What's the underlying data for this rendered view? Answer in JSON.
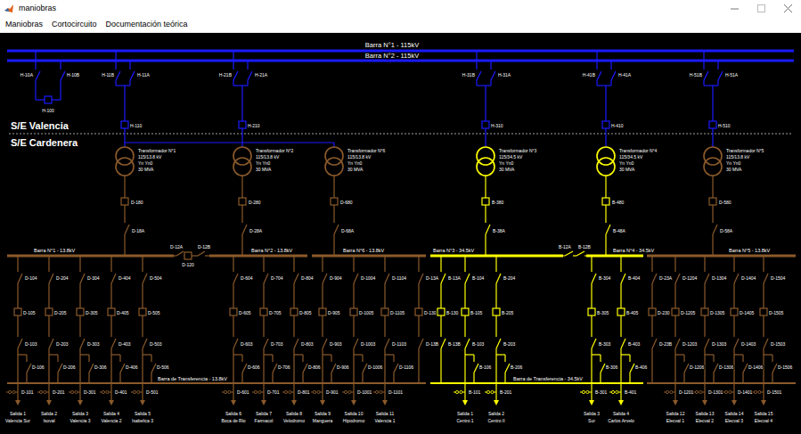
{
  "window": {
    "title": "maniobras"
  },
  "menu": [
    {
      "label": "Maniobras"
    },
    {
      "label": "Cortocircuito"
    },
    {
      "label": "Documentación teórica"
    }
  ],
  "substations": {
    "upper": "S/E Valencia",
    "lower": "S/E Cardenera"
  },
  "hv_buses": [
    {
      "label": "Barra N°1 - 115kV",
      "color": "#1a1aff"
    },
    {
      "label": "Barra N°2 - 115kV",
      "color": "#1a1aff"
    }
  ],
  "hv_coupler": {
    "switch_a": "H-10A",
    "switch_b": "H-10B",
    "breaker": "H-100",
    "color": "#1a1aff"
  },
  "hv_bays": [
    {
      "switch_b": "H-11B",
      "switch_a": "H-11A",
      "breaker": "H-110",
      "color": "#1a1aff"
    },
    {
      "switch_b": "H-21B",
      "switch_a": "H-21A",
      "breaker": "H-210",
      "color": "#1a1aff"
    },
    {
      "switch_b": "H-31B",
      "switch_a": "H-31A",
      "breaker": "H-310",
      "color": "#1a1aff"
    },
    {
      "switch_b": "H-41B",
      "switch_a": "H-41A",
      "breaker": "H-410",
      "color": "#1a1aff"
    },
    {
      "switch_b": "H-51B",
      "switch_a": "H-51A",
      "breaker": "H-510",
      "color": "#1a1aff"
    }
  ],
  "transformers": [
    {
      "name": "Transformador N°1",
      "ratio": "115/13.8 kV",
      "group": "Yn Yn0",
      "rating": "30 MVA",
      "breaker": "D-180",
      "switch": "D-18A",
      "color": "#8b5a2b"
    },
    {
      "name": "Transformador N°2",
      "ratio": "115/13.8 kV",
      "group": "Yn Yn0",
      "rating": "30 MVA",
      "breaker": "D-280",
      "switch": "D-28A",
      "color": "#8b5a2b"
    },
    {
      "name": "Transformador N°6",
      "ratio": "115/13.8 kV",
      "group": "Yn Yn0",
      "rating": "30 MVA",
      "breaker": "D-680",
      "switch": "D-68A",
      "color": "#8b5a2b"
    },
    {
      "name": "Transformador N°3",
      "ratio": "115/34.5 kV",
      "group": "Yn Yn0",
      "rating": "30 MVA",
      "breaker": "B-380",
      "switch": "B-38A",
      "color": "#ffff00"
    },
    {
      "name": "Transformador N°4",
      "ratio": "115/34.5 kV",
      "group": "Yn Yn0",
      "rating": "30 MVA",
      "breaker": "B-480",
      "switch": "B-48A",
      "color": "#ffff00"
    },
    {
      "name": "Transformador N°5",
      "ratio": "115/13.8 kV",
      "group": "Yn Yn0",
      "rating": "30 MVA",
      "breaker": "D-580",
      "switch": "D-58A",
      "color": "#8b5a2b"
    }
  ],
  "lv_buses": [
    {
      "label": "Barra N°1 - 13.8kV",
      "color": "#8b5a2b"
    },
    {
      "label": "Barra N°2 - 13.8kV",
      "color": "#8b5a2b"
    },
    {
      "label": "Barra N°6 - 13.8kV",
      "color": "#8b5a2b"
    },
    {
      "label": "Barra N°3 - 34.5kV",
      "color": "#ffff00"
    },
    {
      "label": "Barra N°4 - 34.5kV",
      "color": "#ffff00"
    },
    {
      "label": "Barra N°5 - 13.8kV",
      "color": "#8b5a2b"
    }
  ],
  "lv_couplers": [
    {
      "kind": "breaker",
      "switch_a": "D-12A",
      "breaker": "D-120",
      "switch_b": "D-12B",
      "color": "#8b5a2b"
    },
    {
      "kind": "switches",
      "switch_a": "B-12A",
      "switch_b": "B-12B",
      "color": "#ffff00"
    }
  ],
  "transfer_buses": [
    {
      "label": "Barra de Transferencia - 13.8kV",
      "color": "#8b5a2b"
    },
    {
      "label": "Barra de Transferencia - 34.5kV",
      "color": "#ffff00"
    },
    {
      "color": "#8b5a2b"
    }
  ],
  "transfer_couplers": [
    {
      "switch_top": "D-13A",
      "breaker": "D-130",
      "switch_bottom": "D-13B",
      "color": "#8b5a2b"
    },
    {
      "switch_top": "B-13A",
      "breaker": "B-130",
      "switch_bottom": "B-13B",
      "color": "#ffff00"
    },
    {
      "switch_top": "D-23A",
      "breaker": "D-230",
      "switch_bottom": "D-23B",
      "color": "#8b5a2b"
    }
  ],
  "feeders": [
    {
      "title": "Salida 1",
      "place": "Valencia Sur",
      "switch_top": "D-104",
      "breaker": "D-105",
      "switch_bottom": "D-103",
      "bypass": "D-106",
      "output": "D-101",
      "color": "#8b5a2b"
    },
    {
      "title": "Salida 2",
      "place": "Isoval",
      "switch_top": "D-204",
      "breaker": "D-205",
      "switch_bottom": "D-203",
      "bypass": "D-206",
      "output": "D-201",
      "color": "#8b5a2b"
    },
    {
      "title": "Salida 3",
      "place": "Valencia 3",
      "switch_top": "D-304",
      "breaker": "D-305",
      "switch_bottom": "D-303",
      "bypass": "D-306",
      "output": "D-301",
      "color": "#8b5a2b"
    },
    {
      "title": "Salida 4",
      "place": "Valencia 2",
      "switch_top": "D-404",
      "breaker": "D-405",
      "switch_bottom": "D-403",
      "bypass": "D-406",
      "output": "D-401",
      "color": "#8b5a2b"
    },
    {
      "title": "Salida 5",
      "place": "Isabelica 3",
      "switch_top": "D-504",
      "breaker": "D-505",
      "switch_bottom": "D-503",
      "bypass": "D-506",
      "output": "D-501",
      "color": "#8b5a2b"
    },
    {
      "title": "Salida 6",
      "place": "Boca de Rio",
      "switch_top": "D-604",
      "breaker": "D-605",
      "switch_bottom": "D-603",
      "bypass": "D-606",
      "output": "D-601",
      "color": "#8b5a2b"
    },
    {
      "title": "Salida 7",
      "place": "Farmacol",
      "switch_top": "D-704",
      "breaker": "D-705",
      "switch_bottom": "D-703",
      "bypass": "D-706",
      "output": "D-701",
      "color": "#8b5a2b"
    },
    {
      "title": "Salida 8",
      "place": "Velodromo",
      "switch_top": "D-804",
      "breaker": "D-805",
      "switch_bottom": "D-803",
      "bypass": "D-806",
      "output": "D-801",
      "color": "#8b5a2b"
    },
    {
      "title": "Salida 9",
      "place": "Manguera",
      "switch_top": "D-904",
      "breaker": "D-905",
      "switch_bottom": "D-903",
      "bypass": "D-906",
      "output": "D-901",
      "color": "#8b5a2b"
    },
    {
      "title": "Salida 10",
      "place": "Hipodromo",
      "switch_top": "D-1004",
      "breaker": "D-1005",
      "switch_bottom": "D-1003",
      "bypass": "D-1006",
      "output": "D-1001",
      "color": "#8b5a2b"
    },
    {
      "title": "Salida 11",
      "place": "Valencia 1",
      "switch_top": "D-1104",
      "breaker": "D-1105",
      "switch_bottom": "D-1103",
      "bypass": "D-1106",
      "output": "D-1101",
      "color": "#8b5a2b"
    },
    {
      "title": "Salida 1",
      "place": "Centro 1",
      "switch_top": "B-104",
      "breaker": "B-105",
      "switch_bottom": "B-103",
      "bypass": "B-106",
      "output": "B-101",
      "color": "#ffff00"
    },
    {
      "title": "Salida 2",
      "place": "Centro II",
      "switch_top": "B-204",
      "breaker": "B-205",
      "switch_bottom": "B-203",
      "bypass": "B-206",
      "output": "B-201",
      "color": "#ffff00"
    },
    {
      "title": "Salida 3",
      "place": "Sur",
      "switch_top": "B-304",
      "breaker": "B-305",
      "switch_bottom": "B-303",
      "bypass": "B-306",
      "output": "B-301",
      "color": "#ffff00"
    },
    {
      "title": "Salida 4",
      "place": "Carlos Arvelo",
      "switch_top": "B-404",
      "breaker": "B-405",
      "switch_bottom": "B-403",
      "bypass": "B-406",
      "output": "B-401",
      "color": "#ffff00"
    },
    {
      "title": "Salida 12",
      "place": "Elecval 1",
      "switch_top": "D-1204",
      "breaker": "D-1205",
      "switch_bottom": "D-1203",
      "bypass": "D-1206",
      "output": "D-1201",
      "color": "#8b5a2b"
    },
    {
      "title": "Salida 13",
      "place": "Elecval 2",
      "switch_top": "D-1304",
      "breaker": "D-1305",
      "switch_bottom": "D-1303",
      "bypass": "D-1306",
      "output": "D-1301",
      "color": "#8b5a2b"
    },
    {
      "title": "Salida 14",
      "place": "Elecval 3",
      "switch_top": "D-1404",
      "breaker": "D-1405",
      "switch_bottom": "D-1403",
      "bypass": "D-1406",
      "output": "D-1401",
      "color": "#8b5a2b"
    },
    {
      "title": "Salida 15",
      "place": "Elecval 4",
      "switch_top": "D-1504",
      "breaker": "D-1505",
      "switch_bottom": "D-1503",
      "bypass": "D-1506",
      "output": "D-1501",
      "color": "#8b5a2b"
    }
  ]
}
